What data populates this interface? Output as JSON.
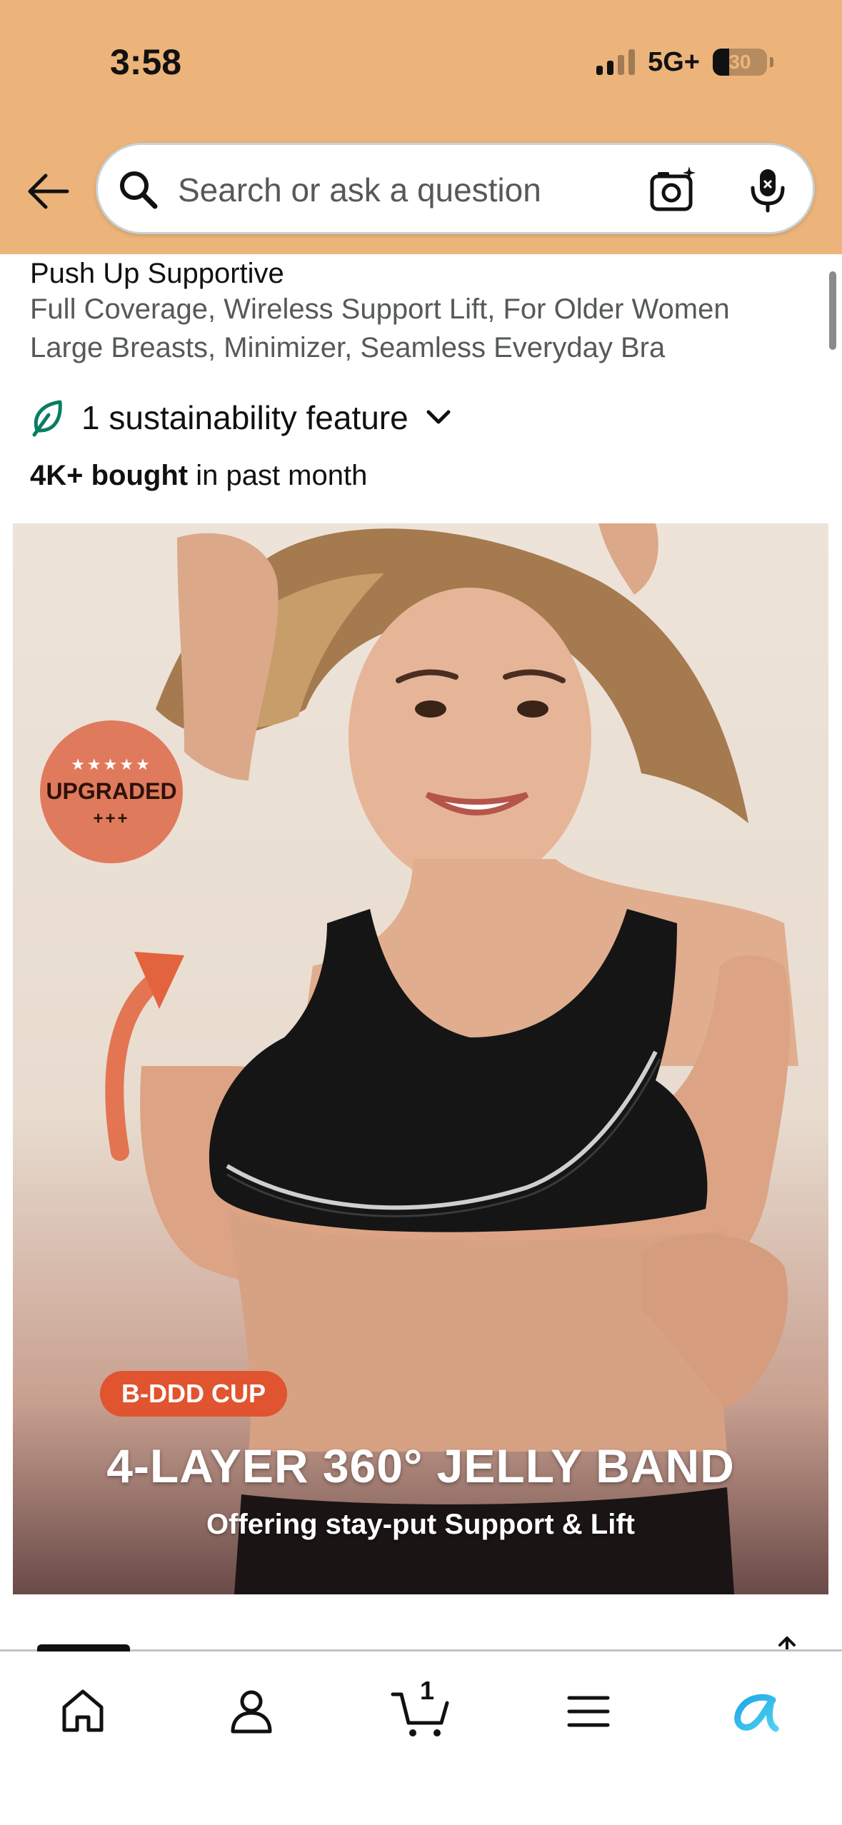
{
  "status_bar": {
    "time": "3:58",
    "network": "5G+",
    "battery": "30",
    "battery_level": 0.3
  },
  "search": {
    "placeholder": "Search or ask a question"
  },
  "product": {
    "title_line_1": "Push Up Supportive",
    "title_line_2": "Full Coverage, Wireless Support Lift, For Older Women",
    "title_line_3": "Large Breasts, Minimizer, Seamless Everyday Bra",
    "sustainability": "1 sustainability feature",
    "bought_bold": "4K+ bought",
    "bought_rest": " in past month"
  },
  "image": {
    "badge_stars": "★★★★★",
    "badge_title": "UPGRADED",
    "badge_plus": "+++",
    "cup_label": "B-DDD CUP",
    "headline": "4-LAYER 360° JELLY BAND",
    "subline": "Offering stay-put Support & Lift"
  },
  "bottom_nav": {
    "items": [
      {
        "name": "home",
        "icon": "home-icon"
      },
      {
        "name": "account",
        "icon": "person-icon"
      },
      {
        "name": "cart",
        "icon": "cart-icon",
        "count": "1"
      },
      {
        "name": "menu",
        "icon": "menu-icon"
      },
      {
        "name": "assistant",
        "icon": "rufus-icon"
      }
    ]
  },
  "colors": {
    "header_bg": "#ecb47a",
    "accent_orange": "#e0542f",
    "sustain_green": "#067d62",
    "assistant_blue": "#1fa6e8"
  }
}
